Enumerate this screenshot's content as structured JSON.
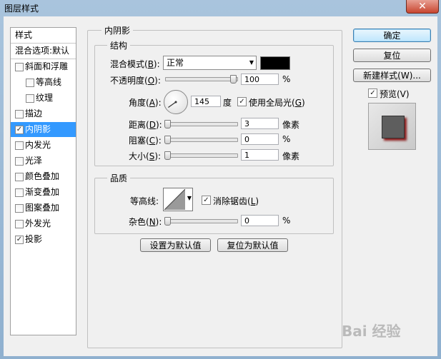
{
  "window": {
    "title": "图层样式",
    "close_glyph": "✕"
  },
  "style_list": {
    "header": "样式",
    "blend_options": "混合选项:默认",
    "items": [
      {
        "label": "斜面和浮雕",
        "checked": false,
        "check": "",
        "indent": false,
        "selected": false
      },
      {
        "label": "等高线",
        "checked": false,
        "check": "",
        "indent": true,
        "selected": false
      },
      {
        "label": "纹理",
        "checked": false,
        "check": "",
        "indent": true,
        "selected": false
      },
      {
        "label": "描边",
        "checked": false,
        "check": "",
        "indent": false,
        "selected": false
      },
      {
        "label": "内阴影",
        "checked": true,
        "check": "✓",
        "indent": false,
        "selected": true
      },
      {
        "label": "内发光",
        "checked": false,
        "check": "",
        "indent": false,
        "selected": false
      },
      {
        "label": "光泽",
        "checked": false,
        "check": "",
        "indent": false,
        "selected": false
      },
      {
        "label": "颜色叠加",
        "checked": false,
        "check": "",
        "indent": false,
        "selected": false
      },
      {
        "label": "渐变叠加",
        "checked": false,
        "check": "",
        "indent": false,
        "selected": false
      },
      {
        "label": "图案叠加",
        "checked": false,
        "check": "",
        "indent": false,
        "selected": false
      },
      {
        "label": "外发光",
        "checked": false,
        "check": "",
        "indent": false,
        "selected": false
      },
      {
        "label": "投影",
        "checked": true,
        "check": "✓",
        "indent": false,
        "selected": false
      }
    ]
  },
  "panel": {
    "title": "内阴影",
    "structure": {
      "title": "结构",
      "blend_mode": {
        "label": "混合模式(",
        "key": "B",
        "suffix": "):",
        "value": "正常",
        "color": "#000000"
      },
      "opacity": {
        "label": "不透明度(",
        "key": "O",
        "suffix": "):",
        "value": "100",
        "unit": "%",
        "level": 1.0
      },
      "angle": {
        "label": "角度(",
        "key": "A",
        "suffix": "):",
        "value": "145",
        "unit": "度",
        "global_light": "使用全局光(",
        "global_key": "G",
        "global_suffix": ")",
        "global_checked": "✓"
      },
      "distance": {
        "label": "距离(",
        "key": "D",
        "suffix": "):",
        "value": "3",
        "unit": "像素",
        "level": 0.0
      },
      "choke": {
        "label": "阻塞(",
        "key": "C",
        "suffix": "):",
        "value": "0",
        "unit": "%",
        "level": 0.0
      },
      "size": {
        "label": "大小(",
        "key": "S",
        "suffix": "):",
        "value": "1",
        "unit": "像素",
        "level": 0.0
      }
    },
    "quality": {
      "title": "品质",
      "contour_label": "等高线:",
      "anti_alias": "消除锯齿(",
      "anti_alias_key": "L",
      "anti_alias_suffix": ")",
      "anti_alias_checked": "✓",
      "noise": {
        "label": "杂色(",
        "key": "N",
        "suffix": "):",
        "value": "0",
        "unit": "%",
        "level": 0.0
      }
    },
    "make_default": "设置为默认值",
    "reset_default": "复位为默认值"
  },
  "buttons": {
    "ok": "确定",
    "reset": "复位",
    "new_style": "新建样式(W)...",
    "preview": "预览(V)",
    "preview_checked": "✓"
  },
  "watermark": "Bai 经验",
  "colors": {
    "selection": "#3399ff",
    "shadow_preview": "#8a1c1c"
  }
}
